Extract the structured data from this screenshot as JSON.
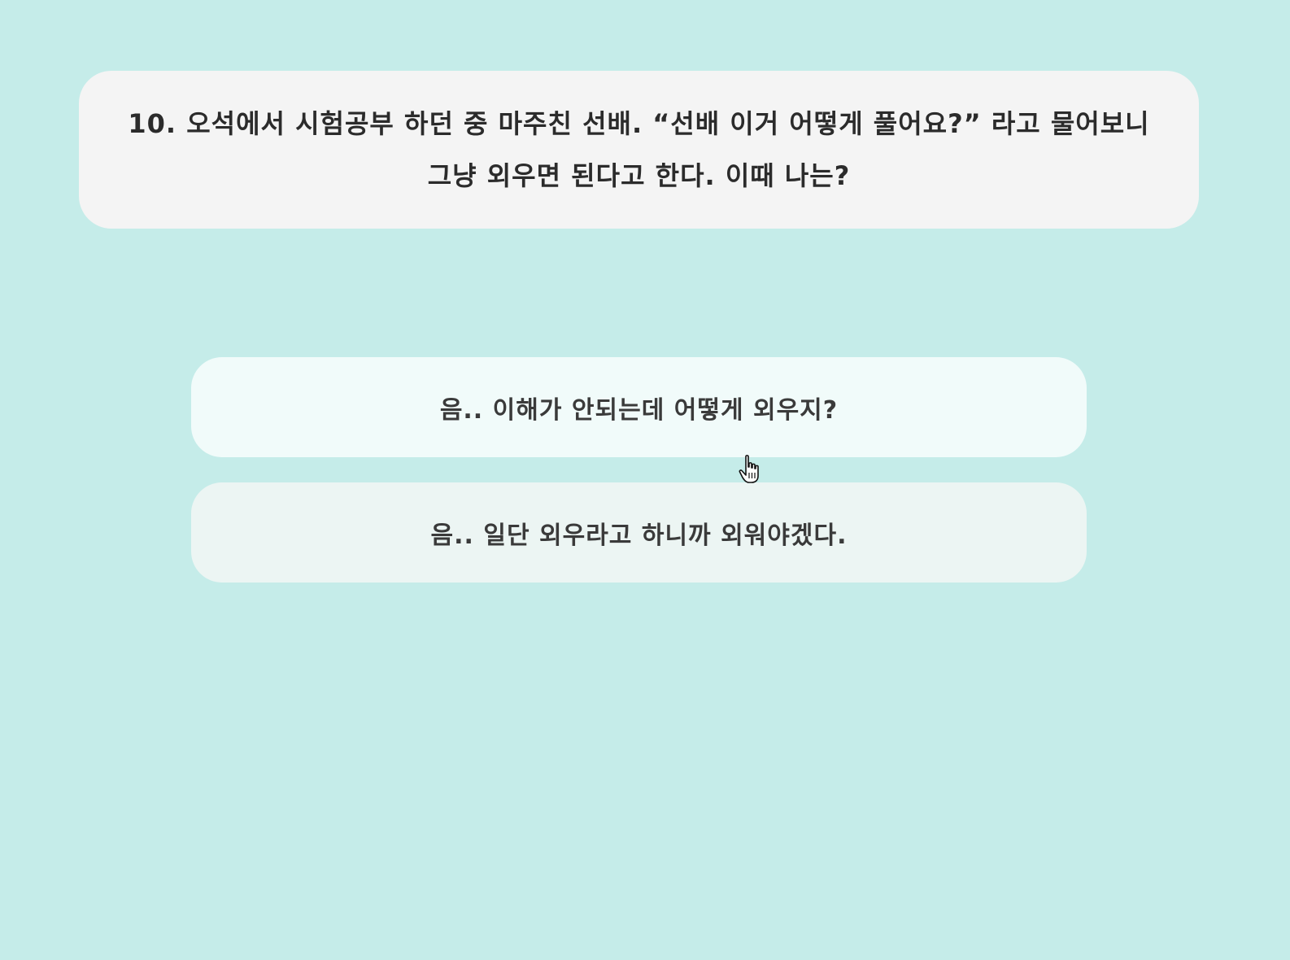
{
  "colors": {
    "background": "#c5ece9",
    "question_card": "#f4f4f4",
    "answer_hovered": "#f1fbfa",
    "answer_default": "#ecf5f3",
    "text": "#2b2b2b"
  },
  "question": {
    "line1": "10. 오석에서 시험공부 하던 중 마주친 선배. “선배 이거 어떻게 풀어요?” 라고 물어보니",
    "line2": "그냥 외우면 된다고 한다. 이때 나는?"
  },
  "answers": [
    {
      "label": "음.. 이해가 안되는데 어떻게 외우지?",
      "hovered": true
    },
    {
      "label": "음.. 일단 외우라고 하니까 외워야겠다.",
      "hovered": false
    }
  ],
  "cursor_icon": "hand-pointer-icon"
}
